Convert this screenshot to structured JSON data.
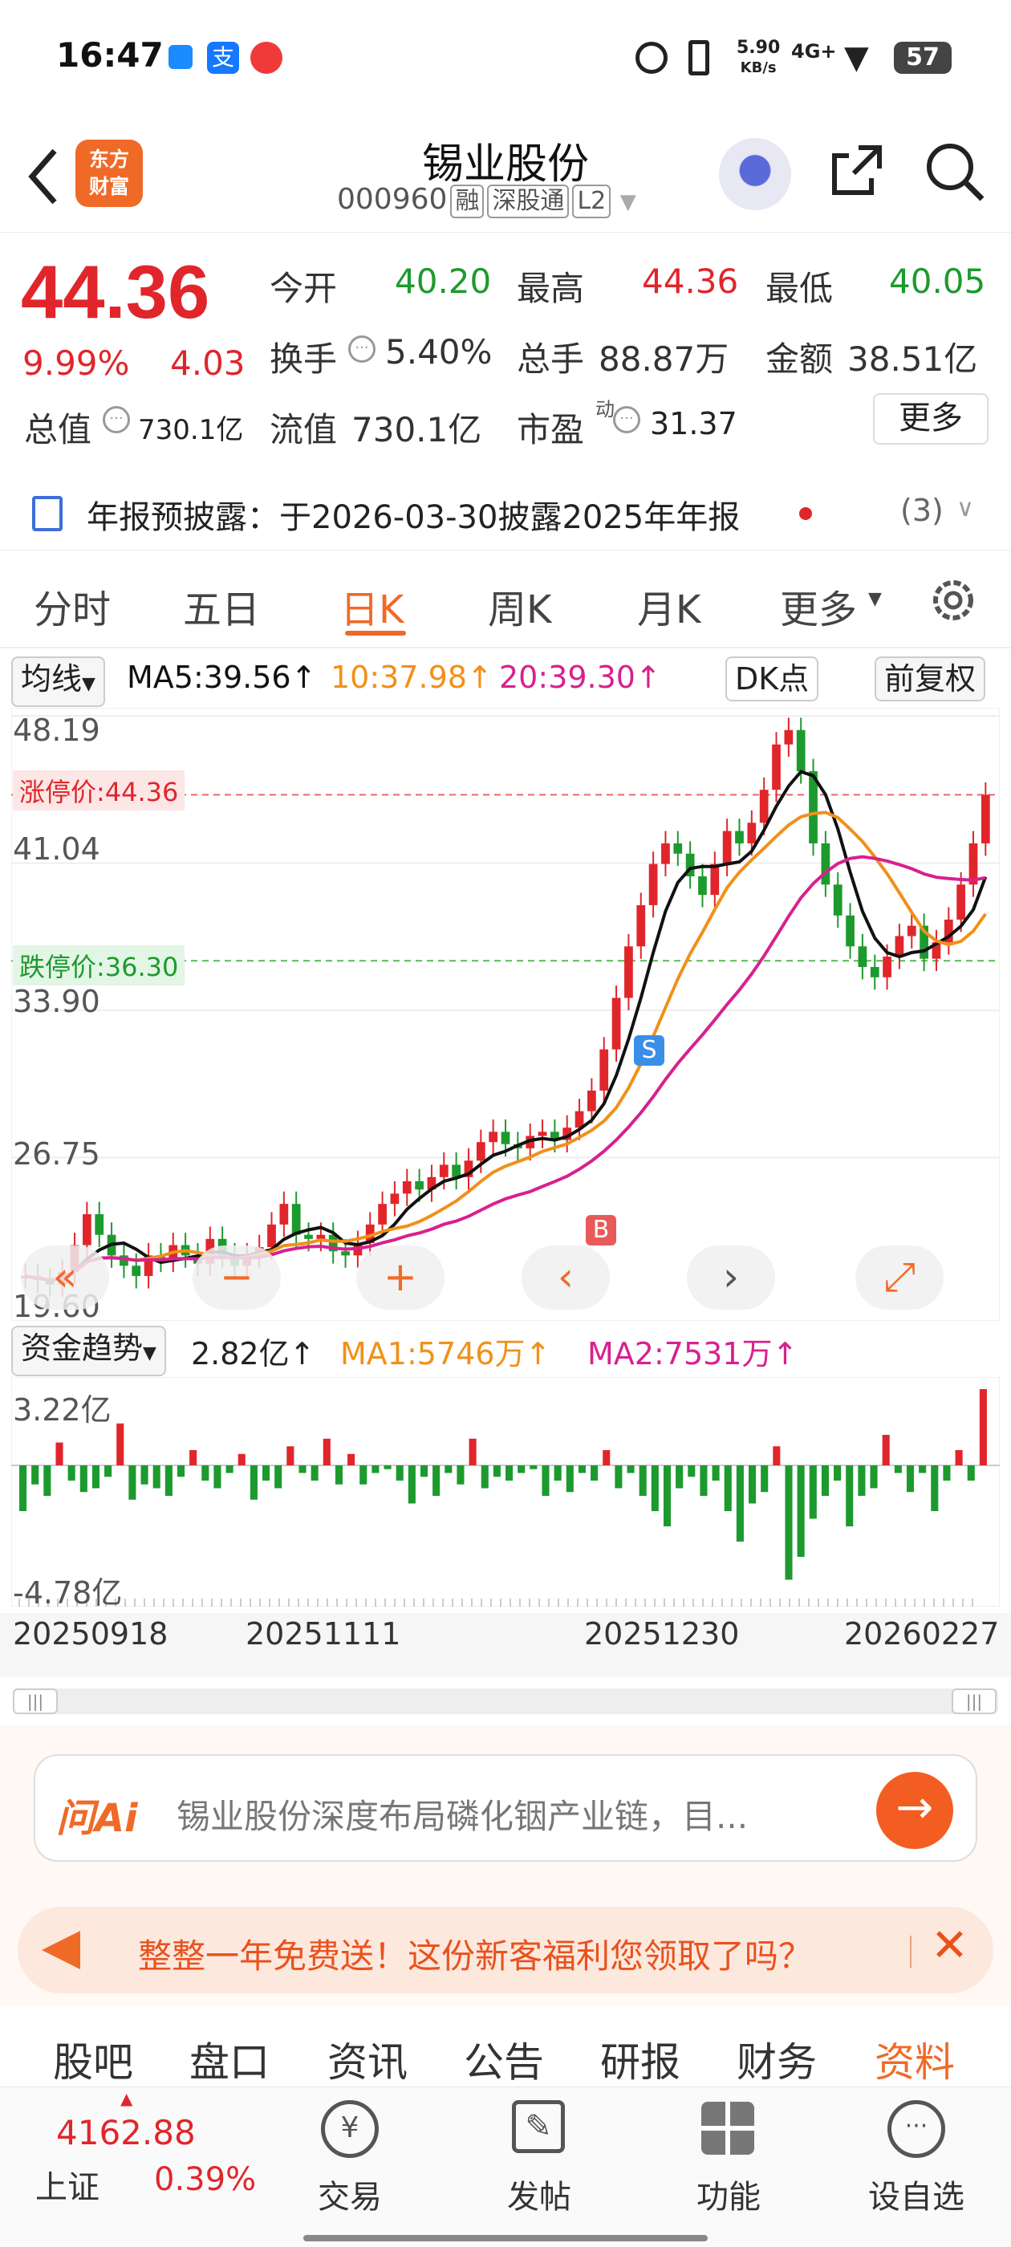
{
  "status_bar": {
    "time": "16:47",
    "net_speed": "5.90",
    "net_unit": "KB/s",
    "signal": "4G+",
    "battery": "57"
  },
  "header": {
    "logo_line1": "东方",
    "logo_line2": "财富",
    "title": "锡业股份",
    "code": "000960",
    "tags": [
      "融",
      "深股通",
      "L2"
    ]
  },
  "quote": {
    "price": "44.36",
    "change_pct": "9.99%",
    "change": "4.03",
    "open_label": "今开",
    "open": "40.20",
    "high_label": "最高",
    "high": "44.36",
    "low_label": "最低",
    "low": "40.05",
    "turnover_label": "换手",
    "turnover": "5.40%",
    "volume_label": "总手",
    "volume": "88.87万",
    "amount_label": "金额",
    "amount": "38.51亿",
    "mktcap_label": "总值",
    "mktcap": "730.1亿",
    "float_label": "流值",
    "float": "730.1亿",
    "pe_label": "市盈",
    "pe_sup": "动",
    "pe": "31.37",
    "more": "更多"
  },
  "notice": {
    "text": "年报预披露：于2026-03-30披露2025年年报",
    "count": "(3)"
  },
  "tabs": [
    "分时",
    "五日",
    "日K",
    "周K",
    "月K",
    "更多"
  ],
  "active_tab": "日K",
  "chart_bar": {
    "ma_type": "均线",
    "ma5": "MA5:39.56",
    "ma10": "10:37.98",
    "ma20": "20:39.30",
    "dk": "DK点",
    "adjust": "前复权"
  },
  "chart_data": {
    "type": "candlestick",
    "y_ticks": [
      "48.19",
      "41.04",
      "33.90",
      "26.75",
      "19.60"
    ],
    "limit_up_label": "涨停价:44.36",
    "limit_down_label": "跌停价:36.30",
    "markers": [
      "S",
      "B"
    ],
    "colors": {
      "up": "#e0262b",
      "down": "#1d9a2e",
      "ma5": "#111111",
      "ma10": "#f0901a",
      "ma20": "#d8208f"
    }
  },
  "fund": {
    "label": "资金趋势",
    "value": "2.82亿",
    "ma1": "MA1:5746万",
    "ma2": "MA2:7531万",
    "top": "3.22亿",
    "bottom": "-4.78亿",
    "dates": [
      "20250918",
      "20251111",
      "20251230",
      "20260227"
    ]
  },
  "ai": {
    "brand": "问Ai",
    "text": "锡业股份深度布局磷化铟产业链，目..."
  },
  "promo": {
    "text": "整整一年免费送！这份新客福利您领取了吗？"
  },
  "subtabs": [
    "股吧",
    "盘口",
    "资讯",
    "公告",
    "研报",
    "财务",
    "资料"
  ],
  "active_subtab": "资料",
  "bottom_nav": {
    "index_value": "4162.88",
    "index_name": "上证",
    "index_change": "0.39%",
    "items": [
      "交易",
      "发帖",
      "功能",
      "设自选"
    ]
  }
}
